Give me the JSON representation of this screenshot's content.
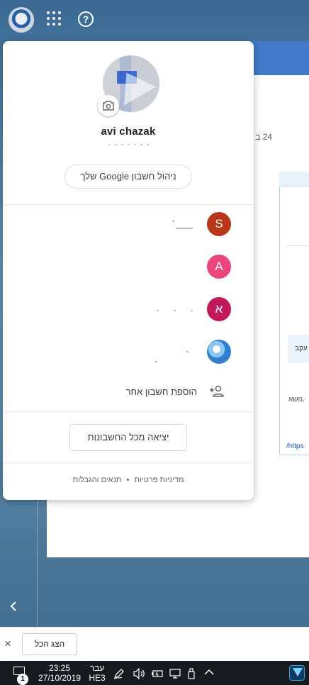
{
  "topbar": {
    "avatar_icon": "user-avatar-icon",
    "apps_icon": "google-apps-grid-icon",
    "help_icon": "help-circle-icon",
    "help_glyph": "?"
  },
  "background_page": {
    "date_fragment": "24 ב",
    "card_text_1": "עקב",
    "card_text_2": "נושא.",
    "card_link": "/https"
  },
  "account_popup": {
    "camera_icon": "camera-icon",
    "user_name": "avi chazak",
    "manage_account_label": "ניהול חשבון Google שלך",
    "other_accounts": [
      {
        "initial": "S",
        "color": "#b8371a"
      },
      {
        "initial": "A",
        "color": "#e8467c"
      },
      {
        "initial": "א",
        "color": "#c2185b"
      },
      {
        "initial": "",
        "color": "#3f8fd8"
      }
    ],
    "add_account_label": "הוספת חשבון אחר",
    "add_account_icon": "person-add-icon",
    "sign_out_label": "יציאה מכל החשבונות",
    "footer": {
      "privacy": "מדיניות פרטיות",
      "separator": "•",
      "terms": "תנאים והגבלות"
    }
  },
  "notification_bar": {
    "close_glyph": "×",
    "show_all_label": "הצג הכל"
  },
  "taskbar": {
    "notification_count": "1",
    "time": "23:25",
    "date": "27/10/2019",
    "lang_top": "עבר",
    "lang_bottom": "HE3"
  }
}
